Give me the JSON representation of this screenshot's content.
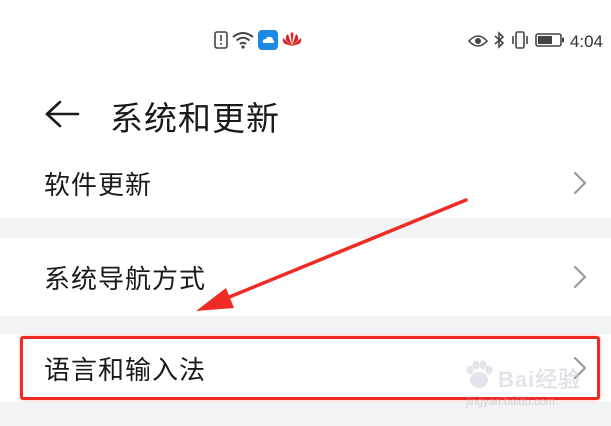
{
  "status_bar": {
    "left_icons": [
      "alert-icon",
      "wifi-icon",
      "cloud-app-icon",
      "huawei-logo-icon"
    ],
    "right_icons": [
      "eye-icon",
      "bluetooth-icon",
      "vibrate-icon",
      "battery-icon"
    ],
    "time": "4:04"
  },
  "header": {
    "back_icon": "arrow-left-icon",
    "title": "系统和更新"
  },
  "list": {
    "items": [
      {
        "label": "软件更新",
        "icon": "chevron-right-icon"
      },
      {
        "label": "系统导航方式",
        "icon": "chevron-right-icon"
      },
      {
        "label": "语言和输入法",
        "icon": "chevron-right-icon"
      }
    ]
  },
  "annotation": {
    "box_color": "#ee2b24",
    "arrow_color": "#ee2b24"
  },
  "watermark": {
    "brand": "Bai经验",
    "sub": "jingyan.baidu.com"
  },
  "colors": {
    "background": "#ffffff",
    "separator": "#f1f3f5",
    "text": "#1a1a1a",
    "chevron": "#9a9a9a"
  }
}
